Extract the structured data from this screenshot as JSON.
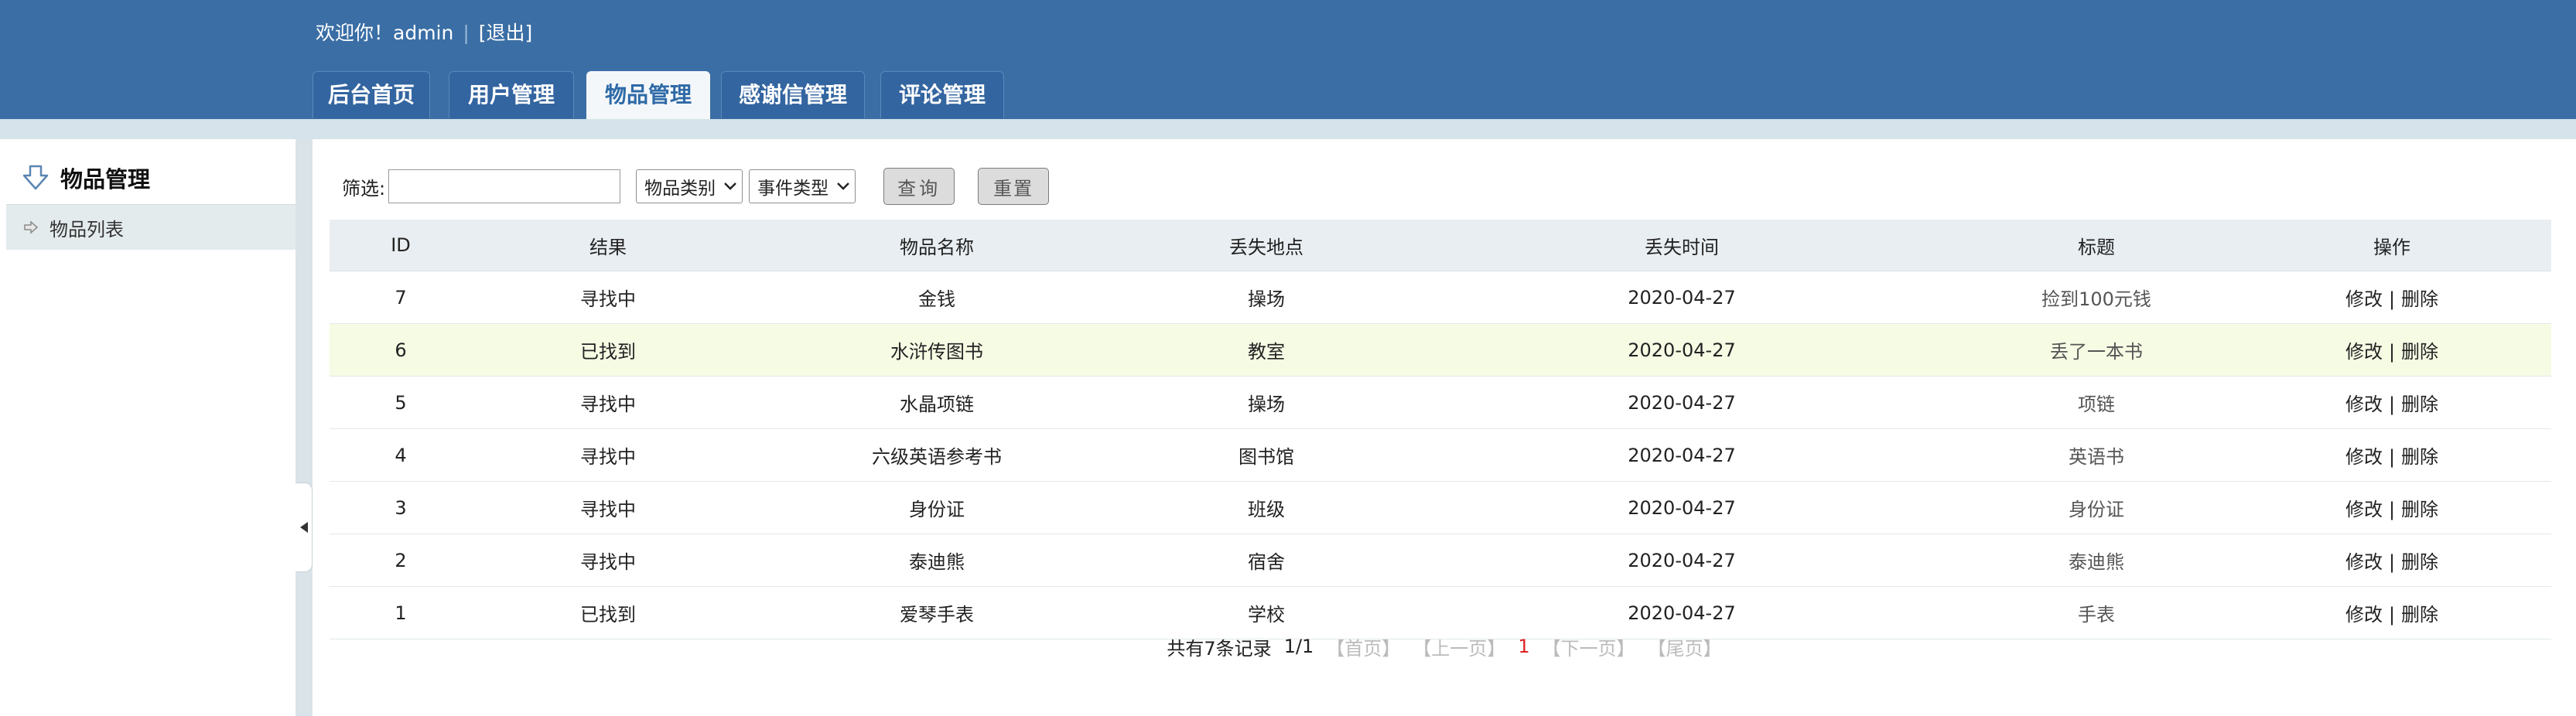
{
  "header": {
    "welcome_text": "欢迎你！admin",
    "separator": "|",
    "logout_label": "[退出]",
    "tabs": [
      {
        "label": "后台首页",
        "active": false
      },
      {
        "label": "用户管理",
        "active": false
      },
      {
        "label": "物品管理",
        "active": true
      },
      {
        "label": "感谢信管理",
        "active": false
      },
      {
        "label": "评论管理",
        "active": false
      }
    ]
  },
  "sidebar": {
    "title": "物品管理",
    "items": [
      {
        "label": "物品列表"
      }
    ]
  },
  "filter": {
    "label": "筛选:",
    "input_value": "",
    "category_select": "物品类别",
    "event_select": "事件类型",
    "query_label": "查询",
    "reset_label": "重置"
  },
  "table": {
    "headers": [
      "ID",
      "结果",
      "物品名称",
      "丢失地点",
      "丢失时间",
      "标题",
      "操作"
    ],
    "rows": [
      {
        "id": "7",
        "result": "寻找中",
        "name": "金钱",
        "place": "操场",
        "time": "2020-04-27",
        "title": "捡到100元钱"
      },
      {
        "id": "6",
        "result": "已找到",
        "name": "水浒传图书",
        "place": "教室",
        "time": "2020-04-27",
        "title": "丢了一本书"
      },
      {
        "id": "5",
        "result": "寻找中",
        "name": "水晶项链",
        "place": "操场",
        "time": "2020-04-27",
        "title": "项链"
      },
      {
        "id": "4",
        "result": "寻找中",
        "name": "六级英语参考书",
        "place": "图书馆",
        "time": "2020-04-27",
        "title": "英语书"
      },
      {
        "id": "3",
        "result": "寻找中",
        "name": "身份证",
        "place": "班级",
        "time": "2020-04-27",
        "title": "身份证"
      },
      {
        "id": "2",
        "result": "寻找中",
        "name": "泰迪熊",
        "place": "宿舍",
        "time": "2020-04-27",
        "title": "泰迪熊"
      },
      {
        "id": "1",
        "result": "已找到",
        "name": "爱琴手表",
        "place": "学校",
        "time": "2020-04-27",
        "title": "手表"
      }
    ],
    "op_edit": "修改",
    "op_sep": "|",
    "op_delete": "删除"
  },
  "pager": {
    "summary": "共有7条记录",
    "page_info": "1/1",
    "first": "【首页】",
    "prev": "【上一页】",
    "current": "1",
    "next": "【下一页】",
    "last": "【尾页】"
  },
  "colors": {
    "header_bg": "#3a6ea5",
    "active_tab_text": "#2f6aa7",
    "highlight_row": "#f6fbe4",
    "current_page": "#dd2222"
  }
}
